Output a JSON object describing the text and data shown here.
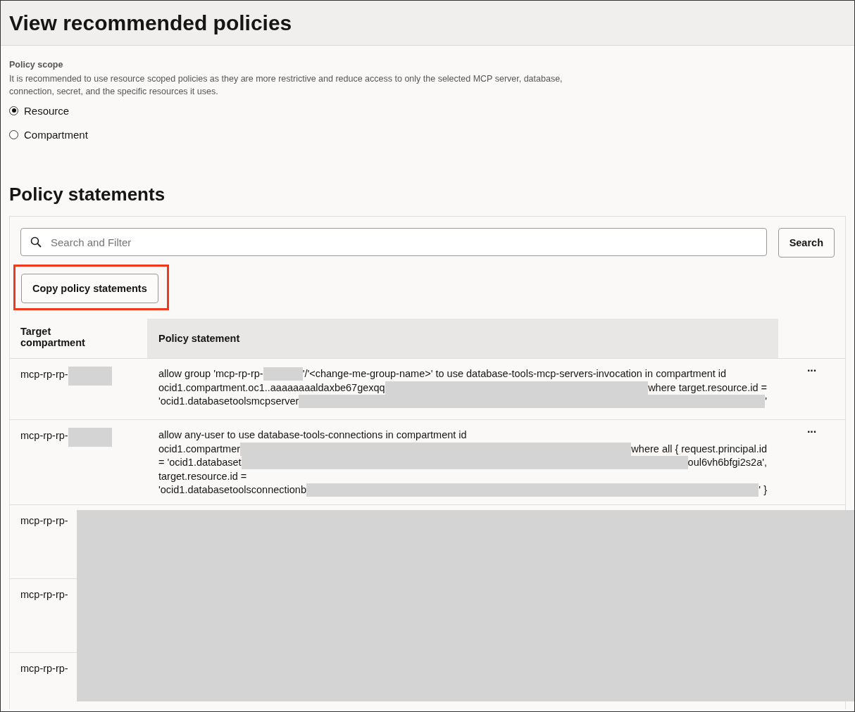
{
  "title": "View recommended policies",
  "policy_scope": {
    "label": "Policy scope",
    "description": "It is recommended to use resource scoped policies as they are more restrictive and reduce access to only the selected MCP server, database, connection, secret, and the specific resources it uses.",
    "options": [
      {
        "label": "Resource",
        "selected": true
      },
      {
        "label": "Compartment",
        "selected": false
      }
    ]
  },
  "section_title": "Policy statements",
  "search": {
    "placeholder": "Search and Filter",
    "button": "Search"
  },
  "copy_button": "Copy policy statements",
  "table": {
    "columns": [
      "Target compartment",
      "Policy statement"
    ],
    "rows": [
      {
        "target": "mcp-rp-rp-",
        "target_masked": true,
        "actions": "···",
        "statement": [
          [
            {
              "kind": "text",
              "text": "allow group 'mcp-rp-rp-"
            },
            {
              "kind": "short-mask"
            },
            {
              "kind": "text",
              "text": "'/'<change-me-group-name>' to use database-tools-mcp-servers-invocation in compartment id"
            }
          ],
          [
            {
              "kind": "text",
              "text": "ocid1.compartment.oc1..aaaaaaaaldaxbe67gexqq"
            },
            {
              "kind": "long-mask"
            },
            {
              "kind": "text",
              "text": "where target.resource.id ="
            }
          ],
          [
            {
              "kind": "text",
              "text": "'ocid1.databasetoolsmcpserver"
            },
            {
              "kind": "long-mask"
            },
            {
              "kind": "text",
              "text": "'"
            }
          ]
        ]
      },
      {
        "target": "mcp-rp-rp-",
        "target_masked": true,
        "actions": "···",
        "statement": [
          [
            {
              "kind": "text",
              "text": "allow any-user to use database-tools-connections in compartment id"
            }
          ],
          [
            {
              "kind": "text",
              "text": "ocid1.compartmer"
            },
            {
              "kind": "long-mask"
            },
            {
              "kind": "text",
              "text": "where all { request.principal.id"
            }
          ],
          [
            {
              "kind": "text",
              "text": "= 'ocid1.databaset"
            },
            {
              "kind": "long-mask"
            },
            {
              "kind": "text",
              "text": "oul6vh6bfgi2s2a',"
            }
          ],
          [
            {
              "kind": "text",
              "text": "target.resource.id ="
            }
          ],
          [
            {
              "kind": "text",
              "text": "'ocid1.databasetoolsconnectionb"
            },
            {
              "kind": "long-mask"
            },
            {
              "kind": "text",
              "text": "' }"
            }
          ]
        ]
      },
      {
        "target": "mcp-rp-rp-",
        "target_masked": false,
        "statement": []
      },
      {
        "target": "mcp-rp-rp-",
        "target_masked": false,
        "statement": []
      },
      {
        "target": "mcp-rp-rp-",
        "target_masked": false,
        "statement": []
      }
    ]
  }
}
